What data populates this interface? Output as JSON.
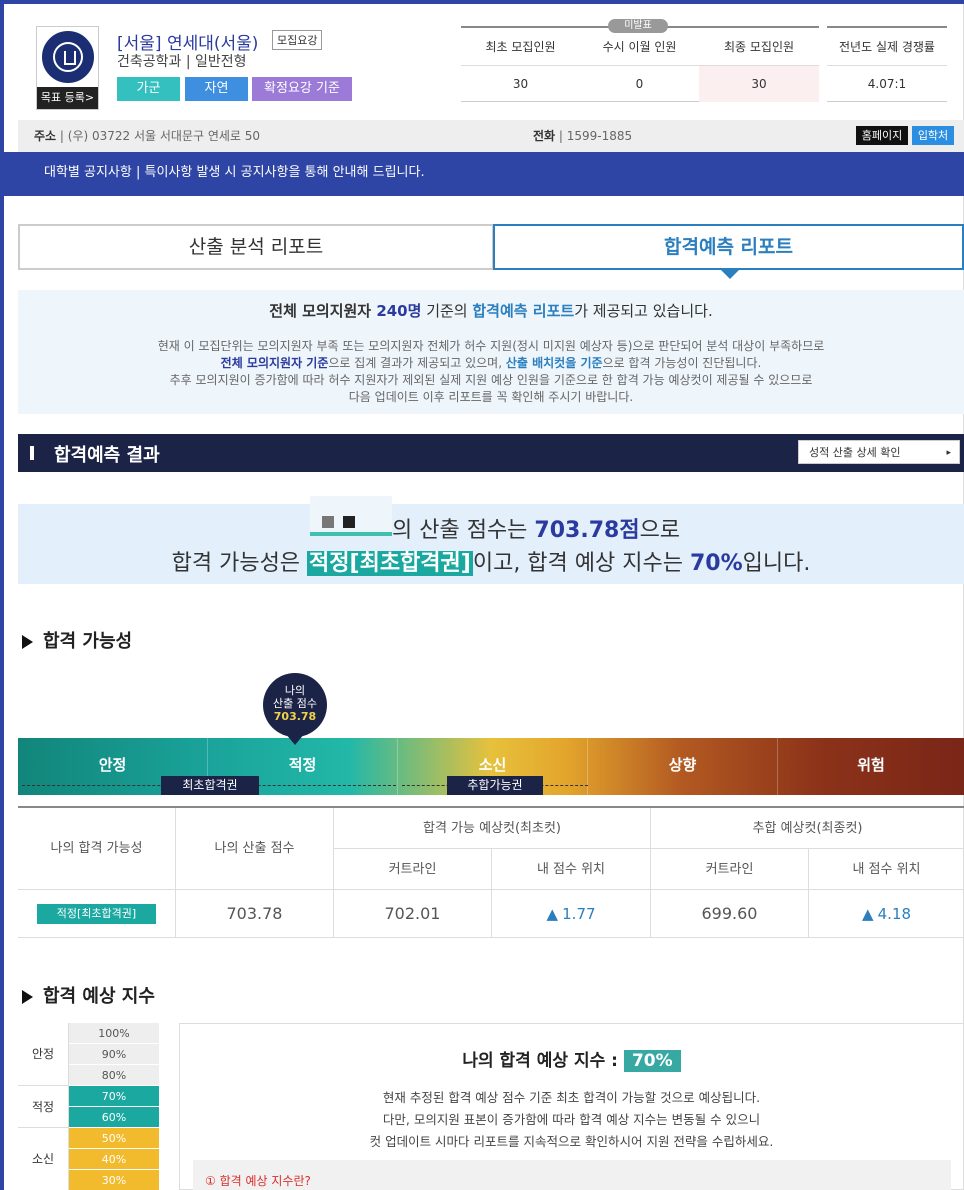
{
  "header": {
    "uni_name": "[서울] 연세대(서울)",
    "guide_badge": "모집요강",
    "dept": "건축공학과 | 일반전형",
    "goal_button": "목표 등록>",
    "tags": [
      "가군",
      "자연",
      "확정요강 기준"
    ],
    "tag_colors": [
      "#35c0c0",
      "#3e8fe0",
      "#9b7ad8"
    ]
  },
  "stats": {
    "unannounced_badge": "미발표",
    "headers": [
      "최초 모집인원",
      "수시 이월 인원",
      "최종 모집인원"
    ],
    "values": [
      "30",
      "0",
      "30"
    ],
    "prev_header": "전년도 실제 경쟁률",
    "prev_value": "4.07:1"
  },
  "address": {
    "label": "주소",
    "value": " | (우) 03722 서울 서대문구 연세로 50",
    "tel_label": "전화",
    "tel_value": " | 1599-1885",
    "home_button": "홈페이지",
    "admission_button": "입학처"
  },
  "notice": "대학별 공지사항   |   특이사항 발생 시 공지사항을 통해 안내해 드립니다.",
  "tabs": [
    "산출 분석 리포트",
    "합격예측 리포트"
  ],
  "info": {
    "l1_a": "전체 모의지원자 ",
    "l1_b": "240명",
    "l1_c": " 기준의 ",
    "l1_d": "합격예측 리포트",
    "l1_e": "가 제공되고 있습니다.",
    "l2": "현재 이 모집단위는 모의지원자 부족 또는 모의지원자 전체가 허수 지원(정시 미지원 예상자 등)으로 판단되어 분석 대상이 부족하므로",
    "l3_a": "전체 모의지원자 기준",
    "l3_b": "으로 집계 결과가 제공되고 있으며, ",
    "l3_c": "산출 배치컷을 기준",
    "l3_d": "으로 합격 가능성이 진단됩니다.",
    "l4": "추후 모의지원이 증가함에 따라 허수 지원자가 제외된 실제 지원 예상 인원을 기준으로 한 합격 가능 예상컷이 제공될 수 있으므로",
    "l5": "다음 업데이트 이후 리포트를 꼭 확인해 주시기 바랍니다."
  },
  "result": {
    "title": "합격예측 결과",
    "detail_button": "성적 산출 상세 확인",
    "detail_arrow": "▸",
    "l1_a": "의 산출 점수는 ",
    "l1_score": "703.78점",
    "l1_b": "으로",
    "l2_a": "합격 가능성은 ",
    "l2_level": "적정[최초합격권]",
    "l2_b": "이고, 합격 예상 지수는 ",
    "l2_pct": "70%",
    "l2_c": "입니다."
  },
  "possibility": {
    "title": "합격 가능성",
    "pin_l1": "나의",
    "pin_l2": "산출 점수",
    "pin_score": "703.78",
    "segments": [
      "안정",
      "적정",
      "소신",
      "상향",
      "위험"
    ],
    "range_labels": [
      "최초합격권",
      "추합가능권"
    ],
    "table": {
      "h_my_possibility": "나의 합격 가능성",
      "h_my_score": "나의 산출 점수",
      "h_first_cut": "합격 가능 예상컷(최초컷)",
      "h_final_cut": "추합 예상컷(최종컷)",
      "h_cutline": "커트라인",
      "h_position": "내 점수 위치",
      "my_possibility": "적정[최초합격권]",
      "my_score": "703.78",
      "first_cutline": "702.01",
      "first_position": "1.77",
      "final_cutline": "699.60",
      "final_position": "4.18",
      "up_symbol": "▲"
    }
  },
  "index": {
    "title": "합격 예상 지수",
    "groups": [
      "안정",
      "적정",
      "소신"
    ],
    "rows": [
      "100%",
      "90%",
      "80%",
      "70%",
      "60%",
      "50%",
      "40%",
      "30%"
    ],
    "row_colors": [
      "#eeeeee",
      "#eeeeee",
      "#eeeeee",
      "#1ba8a0",
      "#1ba8a0",
      "#f2bb2e",
      "#f2bb2e",
      "#f2bb2e"
    ],
    "panel_title": "나의 합격 예상 지수 :",
    "panel_value": "70%",
    "d1": "현재 추정된 합격 예상 점수 기준 최초 합격이 가능할 것으로 예상됩니다.",
    "d2": "다만, 모의지원 표본이 증가함에 따라 합격 예상 지수는 변동될 수 있으니",
    "d3": "컷 업데이트 시마다 리포트를 지속적으로 확인하시어 지원 전략을 수립하세요.",
    "question": "① 합격 예상 지수란?"
  }
}
